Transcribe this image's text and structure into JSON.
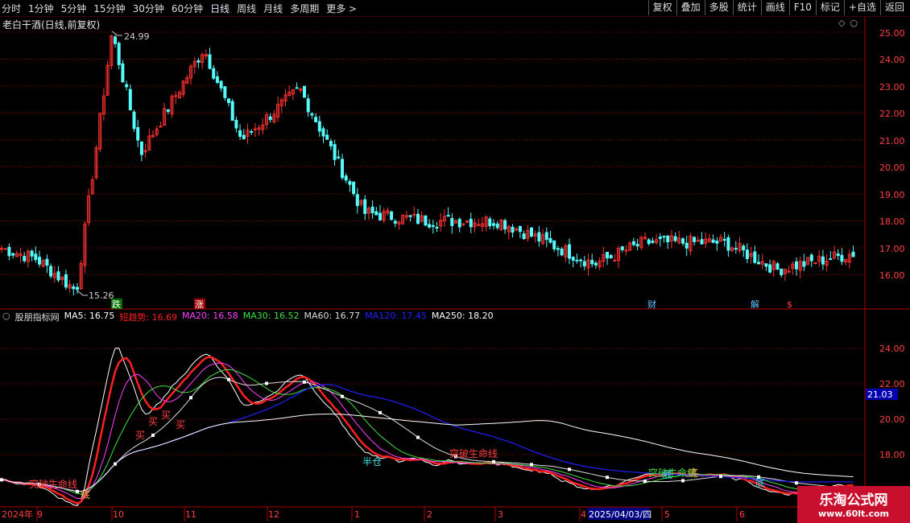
{
  "toolbar": {
    "periods": [
      "分时",
      "1分钟",
      "5分钟",
      "15分钟",
      "30分钟",
      "60分钟",
      "日线",
      "周线",
      "月线",
      "多周期",
      "更多 >"
    ],
    "active_period": "日线",
    "actions": [
      "复权",
      "叠加",
      "多股",
      "统计",
      "画线",
      "F10",
      "标记",
      "+自选",
      "返回"
    ]
  },
  "stock": {
    "title": "老白干酒(日线,前复权)",
    "high_label": "24.99",
    "low_label": "15.26"
  },
  "price_axis": [
    "25.00",
    "24.00",
    "23.00",
    "22.00",
    "21.00",
    "20.00",
    "19.00",
    "18.00",
    "17.00",
    "16.00"
  ],
  "indicator_axis": [
    "24.00",
    "22.00",
    "20.00",
    "18.00"
  ],
  "indicator_current": "21.03",
  "event_markers": [
    "跌",
    "涨",
    "财",
    "解",
    "$"
  ],
  "indicator": {
    "name": "股朋指标网",
    "items": [
      {
        "text": "MA5: 16.75",
        "color": "#ffffff"
      },
      {
        "text": "短趋势: 16.69",
        "color": "#ff2020"
      },
      {
        "text": "MA20: 16.58",
        "color": "#ff40ff"
      },
      {
        "text": "MA30: 16.52",
        "color": "#40e040"
      },
      {
        "text": "MA60: 16.77",
        "color": "#dddddd"
      },
      {
        "text": "MA120: 17.45",
        "color": "#2020ff"
      },
      {
        "text": "MA250: 18.20",
        "color": "#ffffff"
      }
    ]
  },
  "signals": [
    "买",
    "买",
    "买",
    "买",
    "半仓",
    "突破生命线",
    "突破生命线",
    "突破生命线",
    "底",
    "底",
    "底",
    "底"
  ],
  "date_axis": [
    "2024年",
    "9",
    "10",
    "11",
    "12",
    "1",
    "2",
    "3",
    "4",
    "5",
    "6"
  ],
  "date_highlight": "2025/04/03/四",
  "watermark": {
    "line1": "乐淘公式网",
    "line2": "www.60lt.com"
  },
  "colors": {
    "up": "#ff3232",
    "down": "#54fcfc",
    "grid": "#7a0000",
    "frame": "#b00000"
  },
  "chart_data": {
    "type": "candlestick",
    "title": "老白干酒(日线,前复权)",
    "price_range": [
      15.0,
      25.3
    ],
    "max_price": 24.99,
    "min_price": 15.26,
    "close_path_approx": [
      {
        "date": "2024-08",
        "close": 17.0
      },
      {
        "date": "2024-09-start",
        "close": 16.6
      },
      {
        "date": "2024-09-end",
        "close": 15.4
      },
      {
        "date": "2024-10-08",
        "close": 24.99
      },
      {
        "date": "2024-10",
        "close": 20.5
      },
      {
        "date": "2024-11-08",
        "close": 24.4
      },
      {
        "date": "2024-11",
        "close": 21.0
      },
      {
        "date": "2024-12-10",
        "close": 22.9
      },
      {
        "date": "2024-12",
        "close": 21.0
      },
      {
        "date": "2025-01",
        "close": 18.3
      },
      {
        "date": "2025-02",
        "close": 18.0
      },
      {
        "date": "2025-03",
        "close": 18.0
      },
      {
        "date": "2025-04-07",
        "close": 16.4
      },
      {
        "date": "2025-04",
        "close": 17.2
      },
      {
        "date": "2025-05",
        "close": 17.2
      },
      {
        "date": "2025-06",
        "close": 16.2
      },
      {
        "date": "2025-07",
        "close": 16.8
      }
    ],
    "indicator": {
      "ylim": [
        15.5,
        26.0
      ],
      "series": [
        {
          "name": "MA5",
          "last": 16.75
        },
        {
          "name": "短趋势",
          "last": 16.69
        },
        {
          "name": "MA20",
          "last": 16.58
        },
        {
          "name": "MA30",
          "last": 16.52
        },
        {
          "name": "MA60",
          "last": 16.77
        },
        {
          "name": "MA120",
          "last": 17.45
        },
        {
          "name": "MA250",
          "last": 18.2
        }
      ]
    }
  }
}
